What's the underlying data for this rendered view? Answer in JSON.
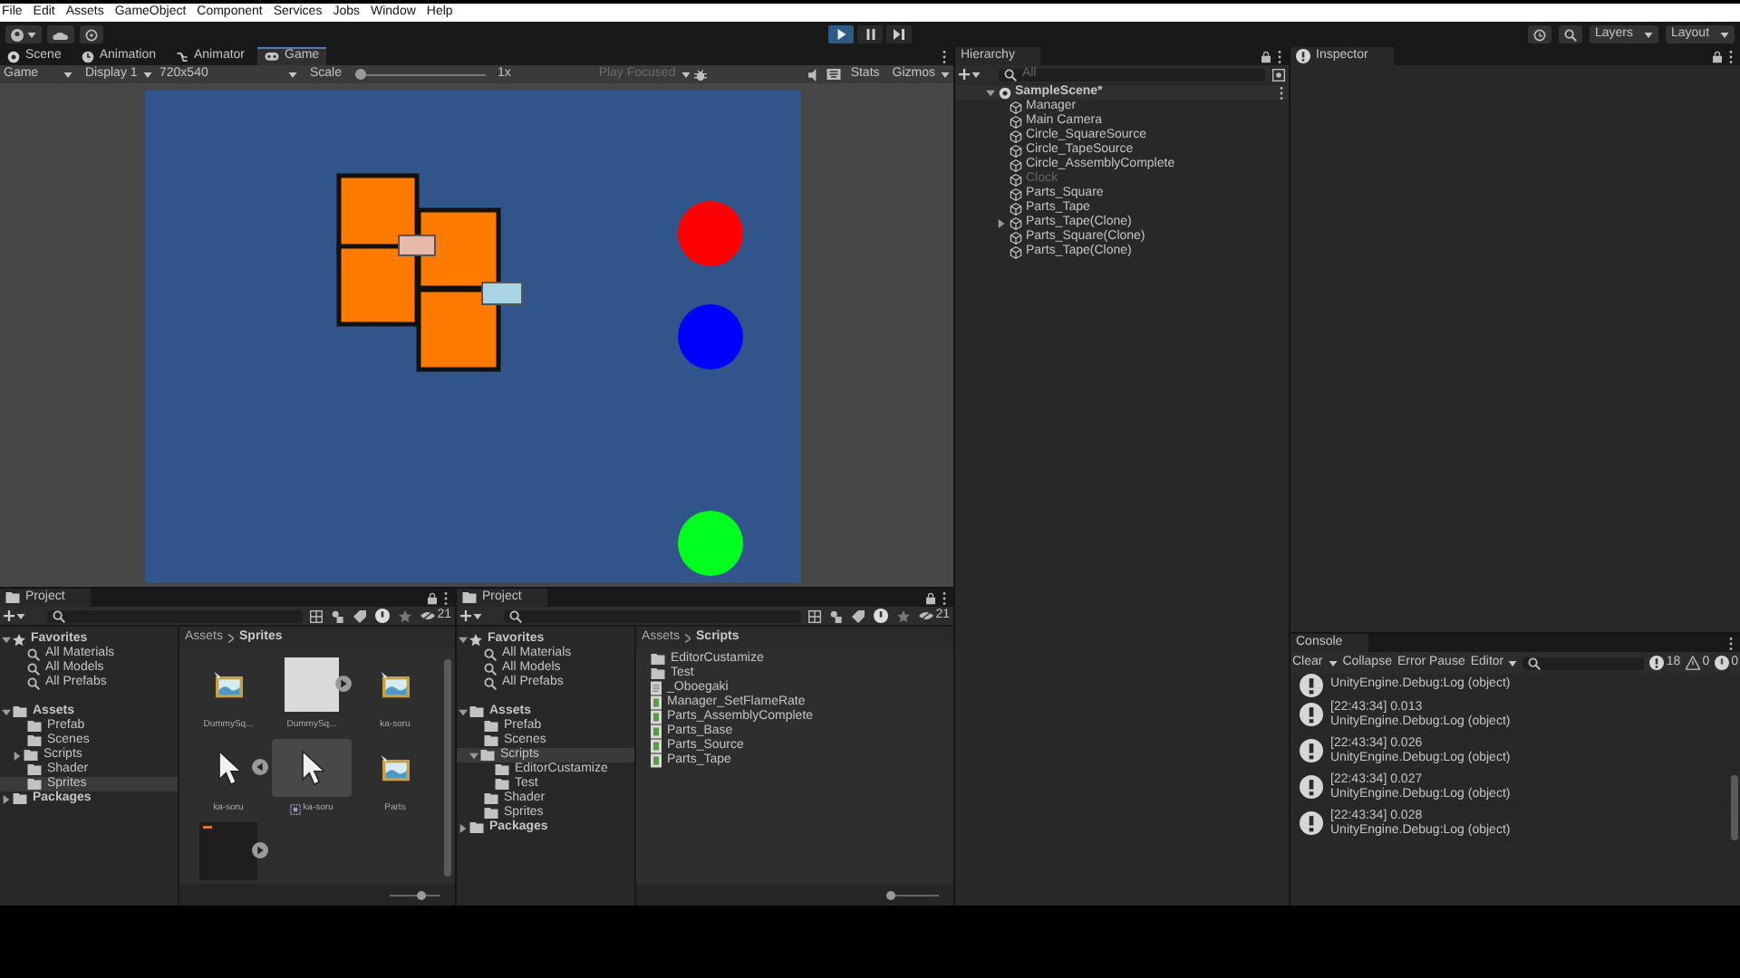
{
  "menu": [
    "File",
    "Edit",
    "Assets",
    "GameObject",
    "Component",
    "Services",
    "Jobs",
    "Window",
    "Help"
  ],
  "toolbar": {
    "play": {
      "on": true
    },
    "pause": {
      "on": false
    },
    "step": {
      "on": false
    },
    "layers": "Layers",
    "layout": "Layout"
  },
  "game": {
    "tabs": [
      {
        "label": "Scene",
        "kind": "scene",
        "selected": false
      },
      {
        "label": "Animation",
        "kind": "animation",
        "selected": false
      },
      {
        "label": "Animator",
        "kind": "animator",
        "selected": false
      },
      {
        "label": "Game",
        "kind": "game",
        "selected": true
      }
    ],
    "mode": "Game",
    "display": "Display 1",
    "resolution": "720x540",
    "scale_label": "Scale",
    "scale": {
      "level": 0
    },
    "scale_value": "1x",
    "play_focused": "Play Focused",
    "stats": "Stats",
    "gizmos": "Gizmos"
  },
  "hierarchy": {
    "title": "Hierarchy",
    "search_placeholder": "All",
    "scene": "SampleScene*",
    "scene_expanded": true,
    "items": [
      {
        "name": "Manager",
        "disabled": false
      },
      {
        "name": "Main Camera",
        "disabled": false
      },
      {
        "name": "Circle_SquareSource",
        "disabled": false
      },
      {
        "name": "Circle_TapeSource",
        "disabled": false
      },
      {
        "name": "Circle_AssemblyComplete",
        "disabled": false
      },
      {
        "name": "Clock",
        "disabled": true
      },
      {
        "name": "Parts_Square",
        "disabled": false
      },
      {
        "name": "Parts_Tape",
        "disabled": false
      },
      {
        "name": "Parts_Tape(Clone)",
        "disabled": false,
        "expanded": false
      },
      {
        "name": "Parts_Square(Clone)",
        "disabled": false
      },
      {
        "name": "Parts_Tape(Clone)",
        "disabled": false
      }
    ]
  },
  "inspector": {
    "title": "Inspector"
  },
  "projects": [
    {
      "title": "Project",
      "hidden_count": "21",
      "kind": "grid",
      "path": [
        "Assets",
        "Sprites"
      ],
      "zoom": {
        "level": 0.6
      },
      "tree": [
        {
          "label": "Favorites",
          "kind": "star",
          "expanded": true,
          "selected": false,
          "children": [
            {
              "label": "All Materials",
              "kind": "search",
              "selected": false
            },
            {
              "label": "All Models",
              "kind": "search",
              "selected": false
            },
            {
              "label": "All Prefabs",
              "kind": "search",
              "selected": false
            }
          ]
        },
        {
          "label": "Assets",
          "kind": "folder",
          "expanded": true,
          "selected": false,
          "children": [
            {
              "label": "Prefab",
              "kind": "folder",
              "selected": false
            },
            {
              "label": "Scenes",
              "kind": "folder",
              "selected": false
            },
            {
              "label": "Scripts",
              "kind": "folder",
              "expanded": false,
              "selected": false
            },
            {
              "label": "Shader",
              "kind": "folder",
              "selected": false
            },
            {
              "label": "Sprites",
              "kind": "folder",
              "selected": true
            }
          ]
        },
        {
          "label": "Packages",
          "kind": "folder",
          "expanded": false,
          "selected": false
        }
      ],
      "items": [
        {
          "name": "DummySq...",
          "kind": "image",
          "selected": false
        },
        {
          "name": "DummySq...",
          "kind": "blank",
          "expanded": false,
          "selected": false
        },
        {
          "name": "ka-soru",
          "kind": "image",
          "selected": false
        },
        {
          "name": "ka-soru",
          "kind": "cursor",
          "expanded": true,
          "selected": false
        },
        {
          "name": "ka-soru",
          "kind": "cursor",
          "selected": true,
          "sub_asset": true
        },
        {
          "name": "Parts",
          "kind": "image",
          "selected": false
        },
        {
          "kind": "animation",
          "expanded": false,
          "selected": false
        }
      ]
    },
    {
      "title": "Project",
      "hidden_count": "21",
      "kind": "list",
      "path": [
        "Assets",
        "Scripts"
      ],
      "zoom": {
        "level": 0.05
      },
      "tree": [
        {
          "label": "Favorites",
          "kind": "star",
          "expanded": true,
          "selected": false,
          "children": [
            {
              "label": "All Materials",
              "kind": "search",
              "selected": false
            },
            {
              "label": "All Models",
              "kind": "search",
              "selected": false
            },
            {
              "label": "All Prefabs",
              "kind": "search",
              "selected": false
            }
          ]
        },
        {
          "label": "Assets",
          "kind": "folder",
          "expanded": true,
          "selected": false,
          "children": [
            {
              "label": "Prefab",
              "kind": "folder",
              "selected": false
            },
            {
              "label": "Scenes",
              "kind": "folder",
              "selected": false
            },
            {
              "label": "Scripts",
              "kind": "folder",
              "expanded": true,
              "selected": true,
              "children": [
                {
                  "label": "EditorCustamize",
                  "kind": "folder",
                  "selected": false
                },
                {
                  "label": "Test",
                  "kind": "folder",
                  "selected": false
                }
              ]
            },
            {
              "label": "Shader",
              "kind": "folder",
              "selected": false
            },
            {
              "label": "Sprites",
              "kind": "folder",
              "selected": false
            }
          ]
        },
        {
          "label": "Packages",
          "kind": "folder",
          "expanded": false,
          "selected": false
        }
      ],
      "items": [
        {
          "name": "EditorCustamize",
          "kind": "folder",
          "selected": false
        },
        {
          "name": "Test",
          "kind": "folder",
          "selected": false
        },
        {
          "name": "_Oboegaki",
          "kind": "text",
          "selected": false
        },
        {
          "name": "Manager_SetFlameRate",
          "kind": "script",
          "selected": false
        },
        {
          "name": "Parts_AssemblyComplete",
          "kind": "script",
          "selected": false
        },
        {
          "name": "Parts_Base",
          "kind": "script",
          "selected": false
        },
        {
          "name": "Parts_Source",
          "kind": "script",
          "selected": false
        },
        {
          "name": "Parts_Tape",
          "kind": "script",
          "selected": false
        }
      ]
    }
  ],
  "console": {
    "title": "Console",
    "clear": "Clear",
    "collapse": "Collapse",
    "error_pause": "Error Pause",
    "source": "Editor",
    "counts": [
      {
        "kind": "info",
        "value": "18"
      },
      {
        "kind": "warning",
        "value": "0"
      },
      {
        "kind": "error",
        "value": "0"
      }
    ],
    "entries": [
      {
        "lines": [
          "UnityEngine.Debug:Log (object)"
        ]
      },
      {
        "lines": [
          "[22:43:34] 0.013",
          "UnityEngine.Debug:Log (object)"
        ]
      },
      {
        "lines": [
          "[22:43:34] 0.026",
          "UnityEngine.Debug:Log (object)"
        ]
      },
      {
        "lines": [
          "[22:43:34] 0.027",
          "UnityEngine.Debug:Log (object)"
        ]
      },
      {
        "lines": [
          "[22:43:34] 0.028",
          "UnityEngine.Debug:Log (object)"
        ]
      }
    ]
  }
}
